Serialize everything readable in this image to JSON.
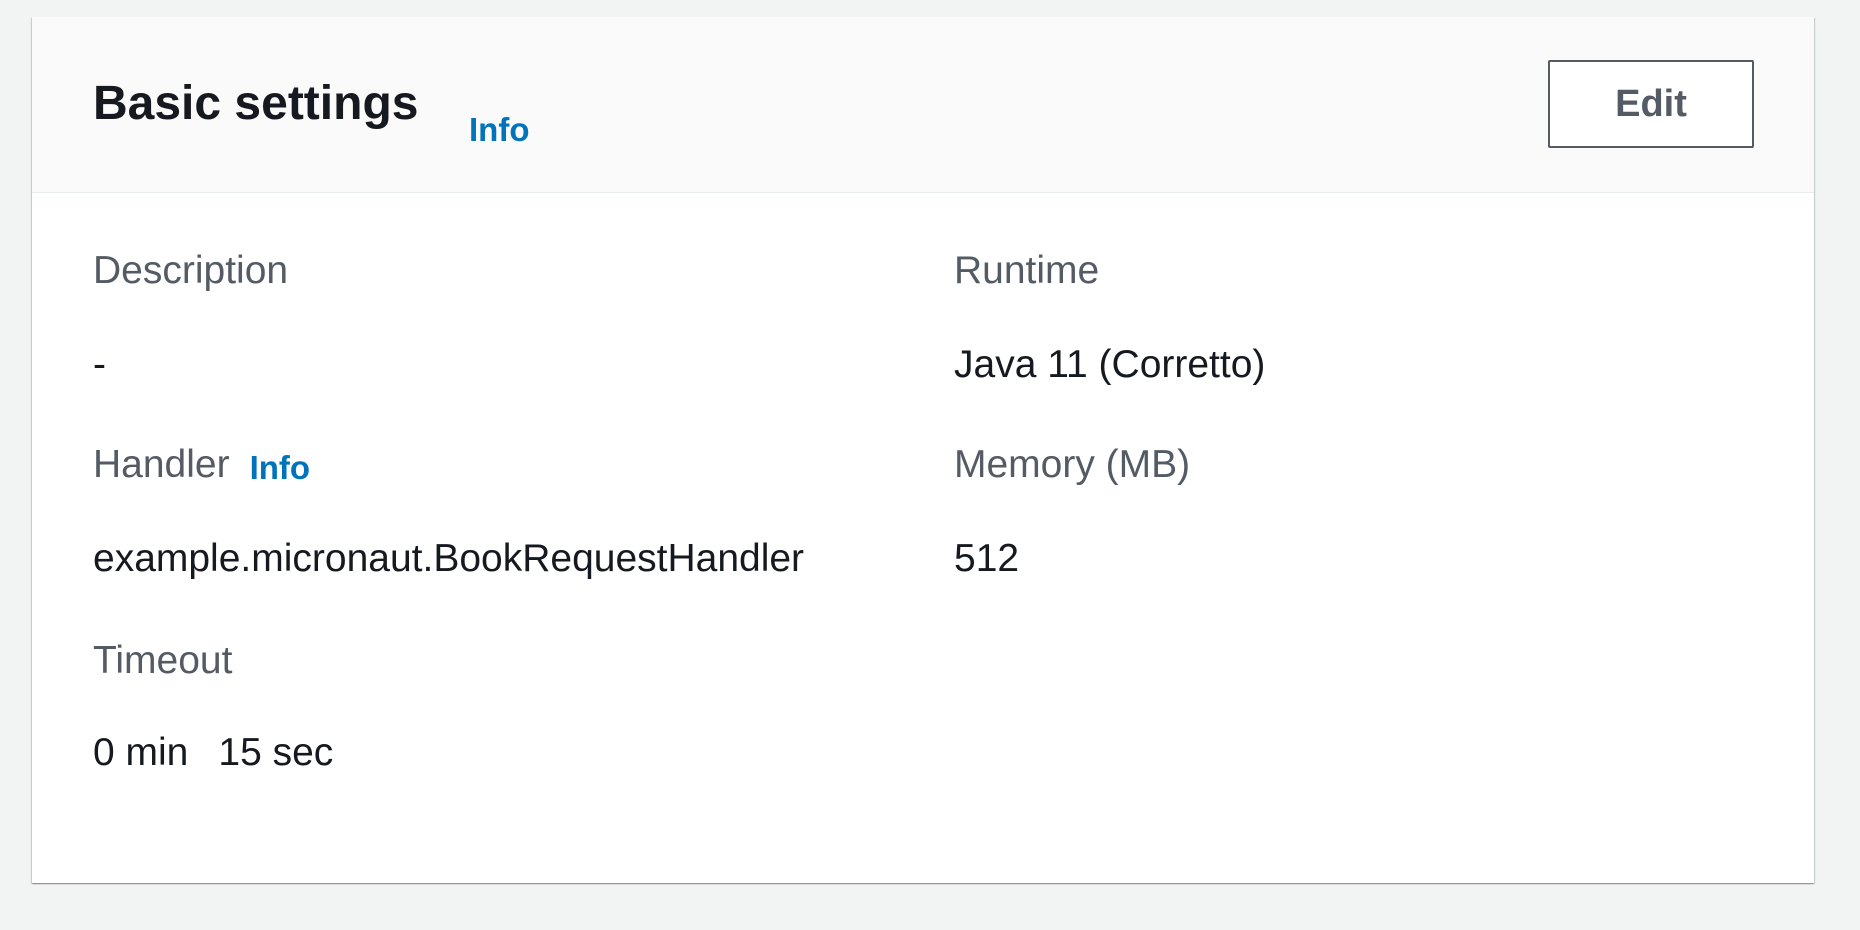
{
  "panel": {
    "title": "Basic settings",
    "info_label": "Info",
    "edit_label": "Edit"
  },
  "fields": {
    "description": {
      "label": "Description",
      "value": "-"
    },
    "runtime": {
      "label": "Runtime",
      "value": "Java 11 (Corretto)"
    },
    "handler": {
      "label": "Handler",
      "info_label": "Info",
      "value": "example.micronaut.BookRequestHandler"
    },
    "memory": {
      "label": "Memory (MB)",
      "value": "512"
    },
    "timeout": {
      "label": "Timeout",
      "minutes": "0 min",
      "seconds": "15 sec"
    }
  },
  "colors": {
    "background": "#f2f3f3",
    "link": "#0073bb",
    "label_text": "#545b64",
    "value_text": "#16191f"
  }
}
